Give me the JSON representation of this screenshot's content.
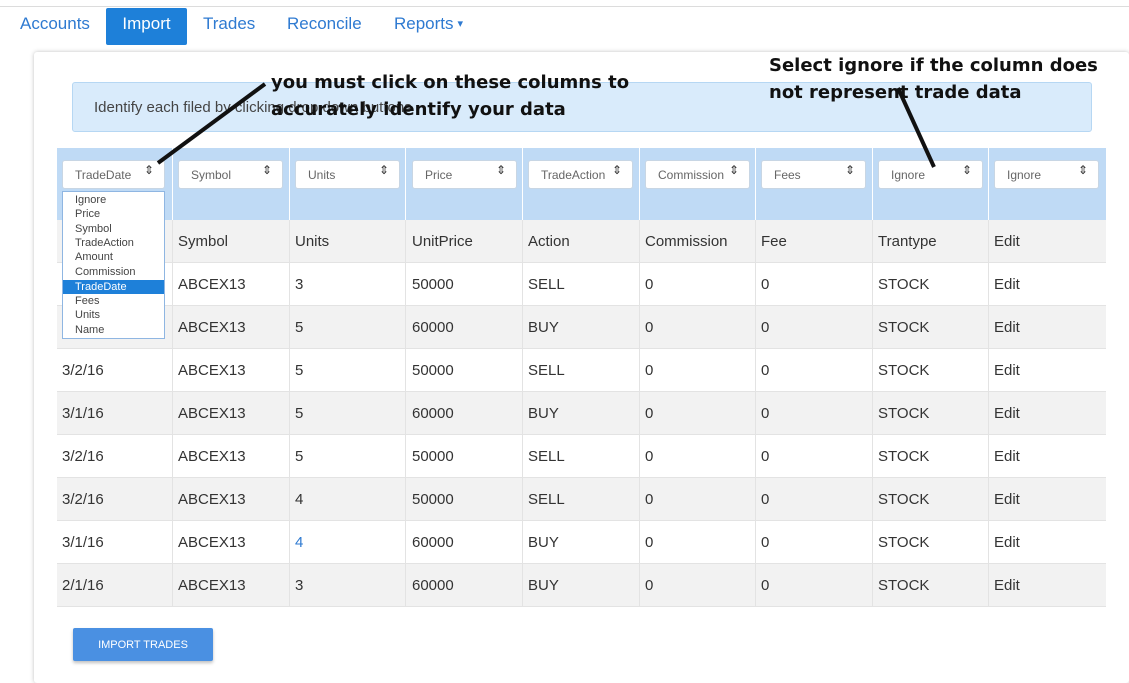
{
  "nav": {
    "tabs": [
      {
        "label": "Accounts"
      },
      {
        "label": "Import"
      },
      {
        "label": "Trades"
      },
      {
        "label": "Reconcile"
      },
      {
        "label": "Reports"
      }
    ],
    "active_tab": "Import",
    "reports_caret": "▾"
  },
  "info_banner": {
    "text": "Identify each filed by clicking drop down buttons"
  },
  "column_selects": [
    {
      "value": "TradeDate"
    },
    {
      "value": "Symbol"
    },
    {
      "value": "Units"
    },
    {
      "value": "Price"
    },
    {
      "value": "TradeAction"
    },
    {
      "value": "Commission"
    },
    {
      "value": "Fees"
    },
    {
      "value": "Ignore"
    },
    {
      "value": "Ignore"
    }
  ],
  "select_arrow_icon": "⇕",
  "dropdown": {
    "options": [
      "Ignore",
      "Price",
      "Symbol",
      "TradeAction",
      "Amount",
      "Commission",
      "TradeDate",
      "Fees",
      "Units",
      "Name"
    ],
    "selected": "TradeDate"
  },
  "table": {
    "headers": [
      "Symbol",
      "Units",
      "UnitPrice",
      "Action",
      "Commission",
      "Fee",
      "Trantype",
      "Edit"
    ],
    "rows": [
      {
        "date": "",
        "symbol": "ABCEX13",
        "units": "3",
        "price": "50000",
        "action": "SELL",
        "commission": "0",
        "fee": "0",
        "trantype": "STOCK",
        "edit": "Edit"
      },
      {
        "date": "",
        "symbol": "ABCEX13",
        "units": "5",
        "price": "60000",
        "action": "BUY",
        "commission": "0",
        "fee": "0",
        "trantype": "STOCK",
        "edit": "Edit"
      },
      {
        "date": "3/2/16",
        "symbol": "ABCEX13",
        "units": "5",
        "price": "50000",
        "action": "SELL",
        "commission": "0",
        "fee": "0",
        "trantype": "STOCK",
        "edit": "Edit"
      },
      {
        "date": "3/1/16",
        "symbol": "ABCEX13",
        "units": "5",
        "price": "60000",
        "action": "BUY",
        "commission": "0",
        "fee": "0",
        "trantype": "STOCK",
        "edit": "Edit"
      },
      {
        "date": "3/2/16",
        "symbol": "ABCEX13",
        "units": "5",
        "price": "50000",
        "action": "SELL",
        "commission": "0",
        "fee": "0",
        "trantype": "STOCK",
        "edit": "Edit"
      },
      {
        "date": "3/2/16",
        "symbol": "ABCEX13",
        "units": "4",
        "price": "50000",
        "action": "SELL",
        "commission": "0",
        "fee": "0",
        "trantype": "STOCK",
        "edit": "Edit"
      },
      {
        "date": "3/1/16",
        "symbol": "ABCEX13",
        "units": "4",
        "price": "60000",
        "action": "BUY",
        "commission": "0",
        "fee": "0",
        "trantype": "STOCK",
        "edit": "Edit"
      },
      {
        "date": "2/1/16",
        "symbol": "ABCEX13",
        "units": "3",
        "price": "60000",
        "action": "BUY",
        "commission": "0",
        "fee": "0",
        "trantype": "STOCK",
        "edit": "Edit"
      }
    ]
  },
  "import_button": {
    "label": "IMPORT TRADES"
  },
  "annotations": {
    "left_line1": "you must click on these columns to",
    "left_line2": "accurately identify your data",
    "right_line1": "Select ignore if the column does",
    "right_line2": "not represent trade data"
  },
  "colors": {
    "accent": "#1e80d9",
    "link": "#2e7ad1",
    "header_band": "#bfdaf5",
    "banner_bg": "#d9ebfb",
    "button": "#4a90e2"
  }
}
